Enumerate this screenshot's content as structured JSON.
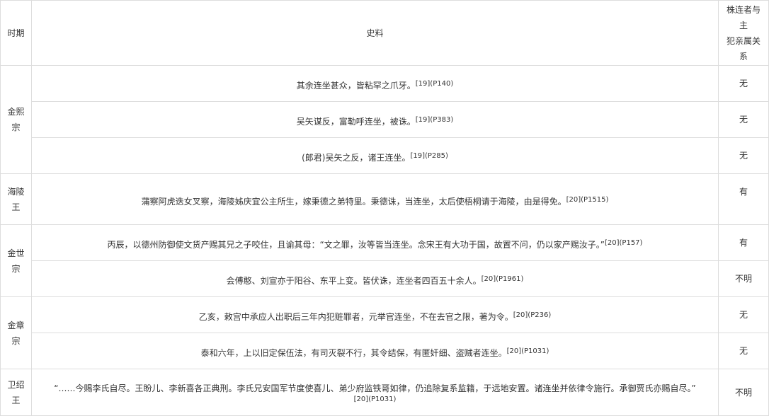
{
  "header": {
    "period": "时期",
    "source": "史料",
    "relation_lines": [
      "株连者与",
      "主",
      "犯亲属关",
      "系"
    ]
  },
  "rows": [
    {
      "period_lines": [
        "金熙",
        "宗"
      ],
      "text": "其余连坐甚众，皆粘罕之爪牙。",
      "ref": "[19](P140)",
      "relation": "无"
    },
    {
      "text": "吴矢谋反，富勒呼连坐，被诛。",
      "ref": "[19](P383)",
      "relation": "无"
    },
    {
      "text": "(郎君)吴矢之反，诸王连坐。",
      "ref": "[19](P285)",
      "relation": "无"
    },
    {
      "period_lines": [
        "海陵",
        "王"
      ],
      "text": "蒲察阿虎迭女叉察，海陵姊庆宜公主所生，嫁秉德之弟特里。秉德诛，当连坐，太后使梧桐请于海陵，由是得免。",
      "ref": "[20](P1515)",
      "relation": "有"
    },
    {
      "period_lines": [
        "金世",
        "宗"
      ],
      "text": "丙辰，以德州防御使文货产赐其兄之子咬住，且谕其母：“文之罪，汝等皆当连坐。念宋王有大功于国，故置不问，仍以家产赐汝子。”",
      "ref": "[20](P157)",
      "relation": "有"
    },
    {
      "text": "会傅憨、刘宣亦于阳谷、东平上变。皆伏诛，连坐者四百五十余人。",
      "ref": "[20](P1961)",
      "relation": "不明"
    },
    {
      "period_lines": [
        "金章",
        "宗"
      ],
      "text": "乙亥，敕宫中承应人出职后三年内犯赃罪者，元举官连坐，不在去官之限，著为令。",
      "ref": "[20](P236)",
      "relation": "无"
    },
    {
      "text": "泰和六年，上以旧定保伍法，有司灭裂不行，其令结保，有匿奸细、盗贼者连坐。",
      "ref": "[20](P1031)",
      "relation": "无"
    },
    {
      "period_lines": [
        "卫绍",
        "王"
      ],
      "text": "“……今赐李氏自尽。王盼儿、李新喜各正典刑。李氏兄安国军节度使喜儿、弟少府监铁哥如律，仍追除复系监籍，于远地安置。诸连坐并依律令施行。承御贾氏亦赐自尽。”",
      "ref": "[20](P1031)",
      "relation": "不明"
    }
  ]
}
